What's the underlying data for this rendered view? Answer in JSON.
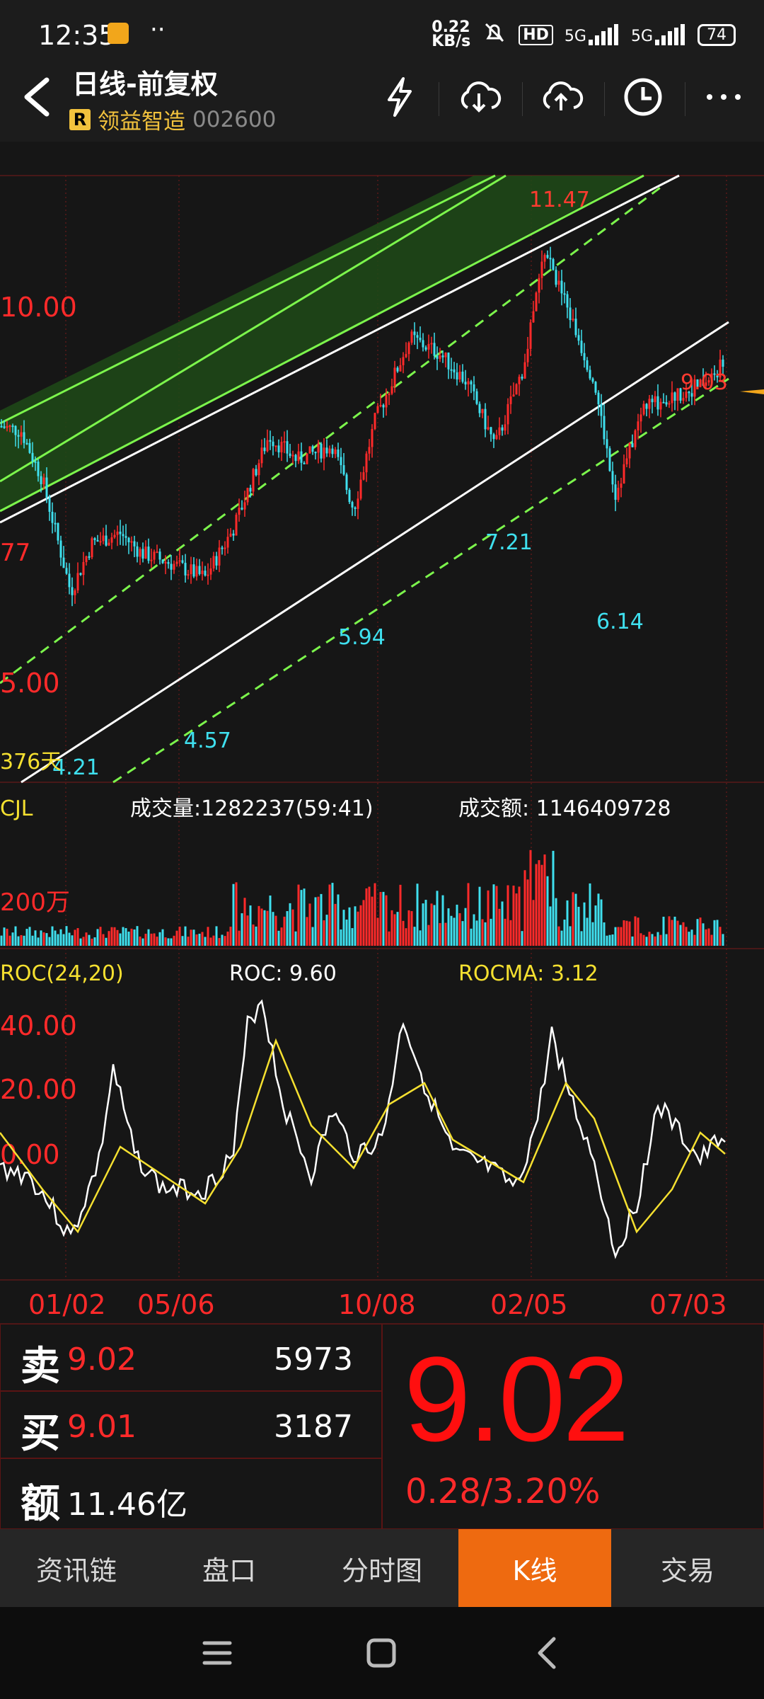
{
  "status_bar": {
    "time": "12:35",
    "dots": "··",
    "net_speed_value": "0.22",
    "net_speed_unit": "KB/s",
    "hd": "HD",
    "sig1": "5G",
    "sig2": "5G",
    "battery": "74"
  },
  "header": {
    "title": "日线-前复权",
    "badge": "R",
    "stock_name": "领益智造",
    "stock_code": "002600"
  },
  "price_chart": {
    "y_labels": [
      "10.00",
      "77",
      "5.00"
    ],
    "price_annotations": [
      {
        "text": "11.47",
        "color": "#ff3b30"
      },
      {
        "text": "9.03",
        "color": "#ff3b30"
      },
      {
        "text": "7.21",
        "color": "#3fe0ef"
      },
      {
        "text": "5.94",
        "color": "#3fe0ef"
      },
      {
        "text": "6.14",
        "color": "#3fe0ef"
      },
      {
        "text": "4.57",
        "color": "#3fe0ef"
      },
      {
        "text": "4.21",
        "color": "#3fe0ef"
      }
    ],
    "days_label": "376天"
  },
  "volume": {
    "indicator": "CJL",
    "volume_label": "成交量:1282237(59:41)",
    "amount_label": "成交额: 1146409728",
    "y_label": "200万"
  },
  "roc": {
    "indicator": "ROC(24,20)",
    "roc_label": "ROC: 9.60",
    "rocma_label": "ROCMA: 3.12",
    "y_labels": [
      "40.00",
      "20.00",
      "0.00"
    ]
  },
  "x_axis": [
    "01/02",
    "05/06",
    "10/08",
    "02/05",
    "07/03"
  ],
  "quote": {
    "sell_label": "卖",
    "sell_price": "9.02",
    "sell_volume": "5973",
    "buy_label": "买",
    "buy_price": "9.01",
    "buy_volume": "3187",
    "amount_label": "额",
    "amount_value": "11.46亿",
    "last_price": "9.02",
    "change": "0.28/3.20%"
  },
  "tabs": [
    "资讯链",
    "盘口",
    "分时图",
    "K线",
    "交易"
  ],
  "colors": {
    "up": "#ff2a2a",
    "down": "#3fe0ef",
    "ma": "#f5e030",
    "channel_green": "#7cf54c",
    "accent": "#ee6a10"
  },
  "icons": {
    "back": "chevron-left-icon",
    "flash": "lightning-icon",
    "cloud_down": "cloud-download-icon",
    "cloud_up": "cloud-upload-icon",
    "clock": "clock-icon",
    "more": "more-dots-icon",
    "nav_menu": "menu-icon",
    "nav_home": "home-square-icon",
    "nav_back": "back-chevron-icon"
  }
}
